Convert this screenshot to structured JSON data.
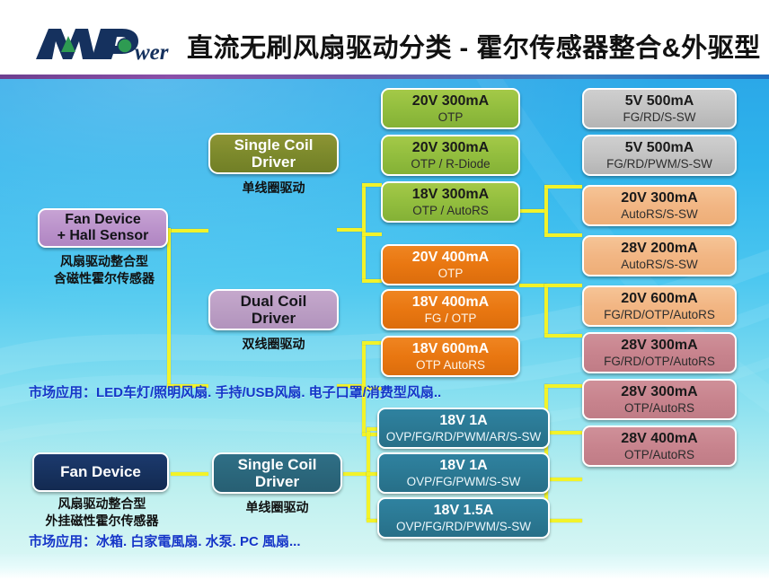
{
  "header": {
    "logo_text": "MPower",
    "logo_alt": "mpower-logo",
    "title": "直流无刷风扇驱动分类 - 霍尔传感器整合&外驱型"
  },
  "colors": {
    "accent_yellow": "#F2F32A",
    "green": "#94BF3F",
    "orange": "#E97711",
    "teal": "#2B7994",
    "gray": "#C3C3C3",
    "peach": "#F2B684",
    "rose": "#C8848E",
    "olive": "#7D8A2C",
    "mauve": "#BB9EC4",
    "navy": "#17325F",
    "root_pink": "#BB93CB",
    "market_text": "#1436C8"
  },
  "roots": [
    {
      "id": "root-hall-integrated",
      "line1": "Fan Device",
      "line2": "+ Hall Sensor",
      "caption1": "风扇驱动整合型",
      "caption2": "含磁性霍尔传感器"
    },
    {
      "id": "root-hall-external",
      "line1": "Fan Device",
      "line2": "",
      "caption1": "风扇驱动整合型",
      "caption2": "外挂磁性霍尔传感器"
    }
  ],
  "drivers": [
    {
      "id": "driver-single-coil-top",
      "line1": "Single Coil",
      "line2": "Driver",
      "caption": "单线圈驱动"
    },
    {
      "id": "driver-dual-coil",
      "line1": "Dual Coil",
      "line2": "Driver",
      "caption": "双线圈驱动"
    },
    {
      "id": "driver-single-coil-bottom",
      "line1": "Single Coil",
      "line2": "Driver",
      "caption": "单线圈驱动"
    }
  ],
  "middle_specs": [
    {
      "id": "spec-green-1",
      "title": "20V 300mA",
      "features": "OTP"
    },
    {
      "id": "spec-green-2",
      "title": "20V 300mA",
      "features": "OTP / R-Diode"
    },
    {
      "id": "spec-green-3",
      "title": "18V 300mA",
      "features": "OTP / AutoRS"
    },
    {
      "id": "spec-orange-1",
      "title": "20V 400mA",
      "features": "OTP"
    },
    {
      "id": "spec-orange-2",
      "title": "18V 400mA",
      "features": "FG / OTP"
    },
    {
      "id": "spec-orange-3",
      "title": "18V 600mA",
      "features": "OTP AutoRS"
    },
    {
      "id": "spec-teal-1",
      "title": "18V 1A",
      "features": "OVP/FG/RD/PWM/AR/S-SW"
    },
    {
      "id": "spec-teal-2",
      "title": "18V 1A",
      "features": "OVP/FG/PWM/S-SW"
    },
    {
      "id": "spec-teal-3",
      "title": "18V 1.5A",
      "features": "OVP/FG/RD/PWM/S-SW"
    }
  ],
  "right_specs": [
    {
      "id": "spec-gray-1",
      "title": "5V 500mA",
      "features": "FG/RD/S-SW"
    },
    {
      "id": "spec-gray-2",
      "title": "5V 500mA",
      "features": "FG/RD/PWM/S-SW"
    },
    {
      "id": "spec-peach-1",
      "title": "20V 300mA",
      "features": "AutoRS/S-SW"
    },
    {
      "id": "spec-peach-2",
      "title": "28V 200mA",
      "features": "AutoRS/S-SW"
    },
    {
      "id": "spec-peach-3",
      "title": "20V 600mA",
      "features": "FG/RD/OTP/AutoRS"
    },
    {
      "id": "spec-rose-1",
      "title": "28V 300mA",
      "features": "FG/RD/OTP/AutoRS"
    },
    {
      "id": "spec-rose-2",
      "title": "28V 300mA",
      "features": "OTP/AutoRS"
    },
    {
      "id": "spec-rose-3",
      "title": "28V 400mA",
      "features": "OTP/AutoRS"
    }
  ],
  "market_notes": [
    {
      "id": "market-note-top",
      "text": "市场应用：LED车灯/照明风扇. 手持/USB风扇. 电子口罩/消费型风扇.."
    },
    {
      "id": "market-note-bottom",
      "text": "市场应用：冰箱. 白家電風扇. 水泵. PC 風扇..."
    }
  ]
}
